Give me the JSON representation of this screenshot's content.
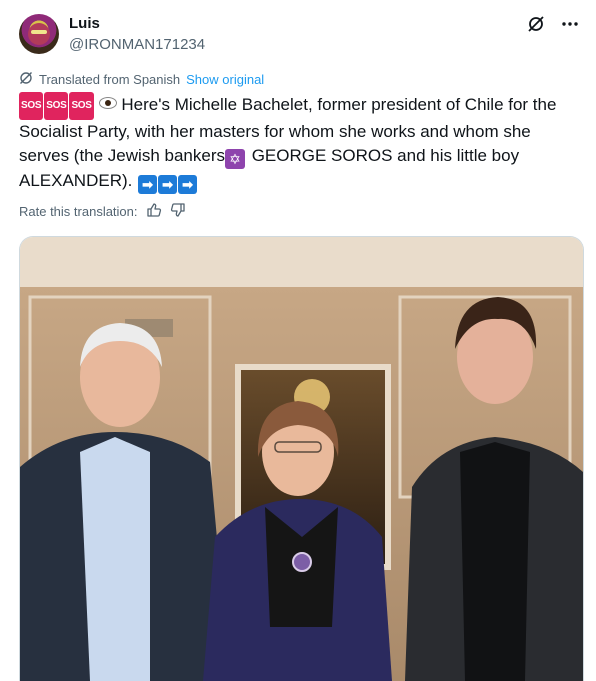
{
  "author": {
    "name": "Luis",
    "handle": "@IRONMAN171234"
  },
  "actions": {
    "grok_icon": "grok-icon",
    "more_icon": "more-icon"
  },
  "translation": {
    "note": "Translated from Spanish",
    "show_original": "Show original",
    "rate_label": "Rate this translation:"
  },
  "tweet": {
    "sos_badge": "SOS",
    "text_part1": "Here's Michelle Bachelet, former president of Chile for the Socialist Party, with her masters for whom she works and whom she serves (the Jewish bankers",
    "text_part2": " GEORGE SOROS and his little boy ALEXANDER).",
    "arrow_glyph": "➡"
  },
  "colors": {
    "link": "#1d9bf0",
    "secondary_text": "#536471"
  }
}
